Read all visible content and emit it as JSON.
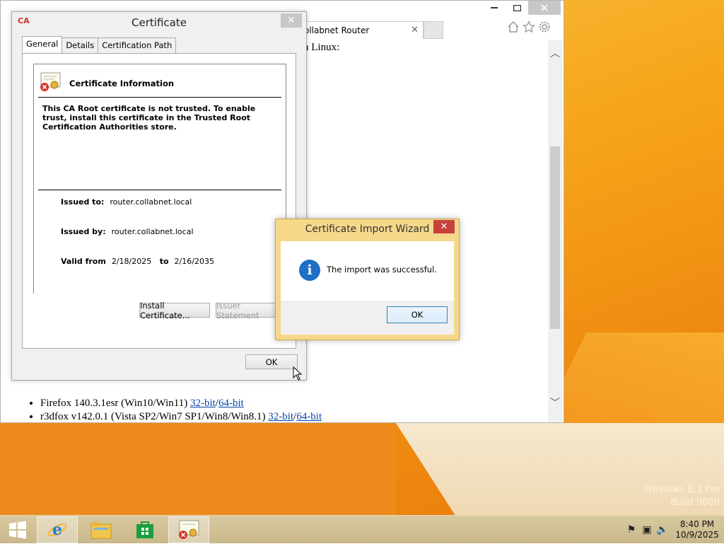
{
  "browser": {
    "tab_title": "ollabnet Router",
    "content_heading": "n Linux:",
    "list_items": [
      {
        "text": "Firefox 140.3.1esr (Win10/Win11) ",
        "link1": "32-bit",
        "sep": "/",
        "link2": "64-bit"
      },
      {
        "text": "r3dfox v142.0.1 (Vista SP2/Win7 SP1/Win8/Win8.1) ",
        "link1": "32-bit",
        "sep": "/",
        "link2": "64-bit"
      }
    ]
  },
  "certificate": {
    "title": "Certificate",
    "app_icon_text": "CA",
    "tabs": [
      {
        "label": "General",
        "active": true
      },
      {
        "label": "Details",
        "active": false
      },
      {
        "label": "Certification Path",
        "active": false
      }
    ],
    "info_title": "Certificate Information",
    "info_message": "This CA Root certificate is not trusted. To enable trust, install this certificate in the Trusted Root Certification Authorities store.",
    "issued_to_label": "Issued to:",
    "issued_to_value": "router.collabnet.local",
    "issued_by_label": "Issued by:",
    "issued_by_value": "router.collabnet.local",
    "valid_from_label": "Valid from",
    "valid_from_value": "2/18/2025",
    "valid_to_label": "to",
    "valid_to_value": "2/16/2035",
    "install_button": "Install Certificate...",
    "issuer_statement_button": "Issuer Statement",
    "ok_button": "OK"
  },
  "wizard": {
    "title": "Certificate Import Wizard",
    "message": "The import was successful.",
    "ok_button": "OK",
    "info_glyph": "i"
  },
  "desktop": {
    "watermark_line1": "Windows 8.1 Pro",
    "watermark_line2": "Build 9600"
  },
  "taskbar": {
    "clock_time": "8:40 PM",
    "clock_date": "10/9/2025"
  }
}
